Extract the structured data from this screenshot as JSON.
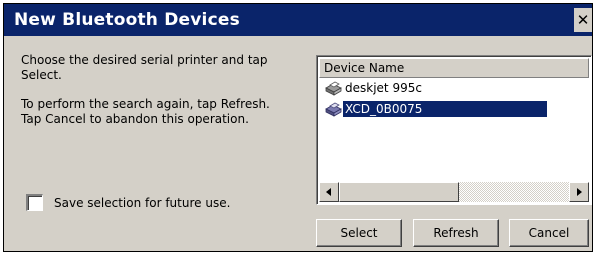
{
  "window": {
    "title": "New Bluetooth Devices",
    "close_glyph": "✕"
  },
  "instructions": {
    "line1": "Choose the desired serial printer and tap Select.",
    "line2": "To perform the search again, tap Refresh.",
    "line3": "Tap Cancel to abandon this operation."
  },
  "save_checkbox": {
    "label": "Save selection for future use.",
    "checked": false
  },
  "device_list": {
    "column_header": "Device Name",
    "devices": [
      {
        "name": "deskjet 995c",
        "icon": "printer-icon",
        "selected": false
      },
      {
        "name": "XCD_0B0075",
        "icon": "printer-icon",
        "selected": true
      }
    ]
  },
  "buttons": {
    "select": "Select",
    "refresh": "Refresh",
    "cancel": "Cancel"
  },
  "colors": {
    "titlebar": "#0a246a",
    "selection": "#0a246a",
    "face": "#d4d0c8"
  }
}
